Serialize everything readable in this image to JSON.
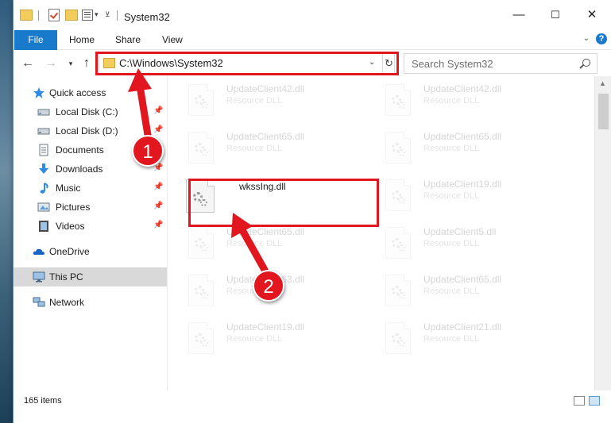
{
  "window": {
    "title": "System32",
    "controls": {
      "minimize": "—",
      "maximize": "☐",
      "close": "✕"
    }
  },
  "ribbon": {
    "tabs": [
      "File",
      "Home",
      "Share",
      "View"
    ],
    "help": "?"
  },
  "address": {
    "path": "C:\\Windows\\System32",
    "refresh_icon": "↻"
  },
  "search": {
    "placeholder": "Search System32"
  },
  "sidebar": {
    "quick_access": "Quick access",
    "items": [
      {
        "label": "Local Disk (C:)",
        "icon": "drive-icon",
        "pinned": true
      },
      {
        "label": "Local Disk (D:)",
        "icon": "drive-icon",
        "pinned": true
      },
      {
        "label": "Documents",
        "icon": "documents-icon",
        "pinned": true
      },
      {
        "label": "Downloads",
        "icon": "downloads-icon",
        "pinned": true
      },
      {
        "label": "Music",
        "icon": "music-icon",
        "pinned": true
      },
      {
        "label": "Pictures",
        "icon": "pictures-icon",
        "pinned": true
      },
      {
        "label": "Videos",
        "icon": "videos-icon",
        "pinned": true
      }
    ],
    "onedrive": "OneDrive",
    "this_pc": "This PC",
    "network": "Network"
  },
  "files": [
    {
      "name": "UpdateClient42.dll",
      "type": "Resource DLL",
      "faded": true
    },
    {
      "name": "UpdateClient42.dll",
      "type": "Resource DLL",
      "faded": true
    },
    {
      "name": "UpdateClient65.dll",
      "type": "Resource DLL",
      "faded": true
    },
    {
      "name": "UpdateClient65.dll",
      "type": "Resource DLL",
      "faded": true
    },
    {
      "name": "wkssIng.dll",
      "type": "",
      "faded": false
    },
    {
      "name": "UpdateClient19.dll",
      "type": "Resource DLL",
      "faded": true
    },
    {
      "name": "UpdateClient65.dll",
      "type": "Resource DLL",
      "faded": true
    },
    {
      "name": "UpdateClient5.dll",
      "type": "Resource DLL",
      "faded": true
    },
    {
      "name": "UpdateClient63.dll",
      "type": "Resource DLL",
      "faded": true
    },
    {
      "name": "UpdateClient65.dll",
      "type": "Resource DLL",
      "faded": true
    },
    {
      "name": "UpdateClient19.dll",
      "type": "Resource DLL",
      "faded": true
    },
    {
      "name": "UpdateClient21.dll",
      "type": "Resource DLL",
      "faded": true
    }
  ],
  "status": {
    "item_count": "165 items"
  },
  "annotations": {
    "step1": "1",
    "step2": "2",
    "color": "#e1161f"
  },
  "colors": {
    "accent": "#1979ca",
    "highlight": "#e1161f",
    "selection": "#d9d9d9"
  }
}
